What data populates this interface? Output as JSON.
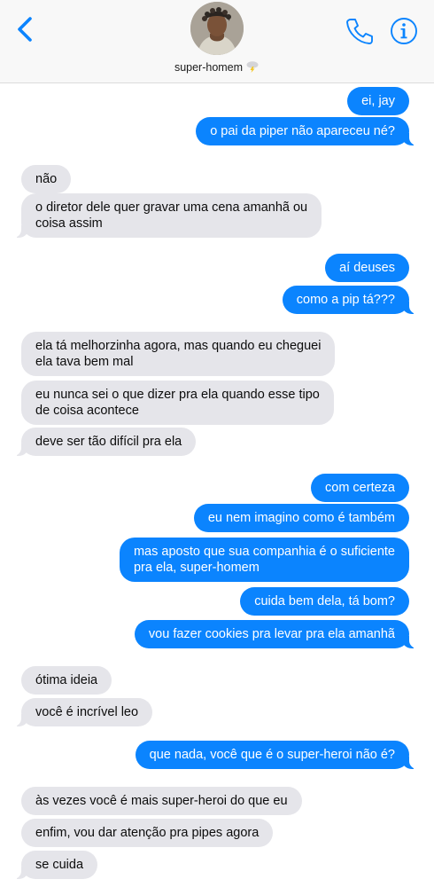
{
  "header": {
    "contact_name": "super-homem",
    "icons": {
      "back": "chevron-left-icon",
      "phone": "phone-icon",
      "info": "info-icon",
      "name_emoji": "cloud-lightning-icon"
    },
    "accent_color": "#0b84fe"
  },
  "messages": [
    {
      "from": "me",
      "text": "ei, jay"
    },
    {
      "from": "me",
      "text": "o pai da piper não apareceu né?"
    },
    {
      "from": "them",
      "text": "não"
    },
    {
      "from": "them",
      "text": "o diretor dele quer gravar uma cena amanhã ou\ncoisa assim"
    },
    {
      "from": "me",
      "text": "aí deuses"
    },
    {
      "from": "me",
      "text": "como a pip tá???"
    },
    {
      "from": "them",
      "text": "ela tá melhorzinha agora, mas quando eu cheguei\nela tava bem mal"
    },
    {
      "from": "them",
      "text": "eu nunca sei o que dizer pra ela quando esse tipo\nde coisa acontece"
    },
    {
      "from": "them",
      "text": "deve ser tão difícil pra ela"
    },
    {
      "from": "me",
      "text": "com certeza"
    },
    {
      "from": "me",
      "text": "eu nem imagino como é também"
    },
    {
      "from": "me",
      "text": "mas aposto que sua companhia é o suficiente\npra ela, super-homem"
    },
    {
      "from": "me",
      "text": "cuida bem dela, tá bom?"
    },
    {
      "from": "me",
      "text": "vou fazer cookies pra levar pra ela amanhã"
    },
    {
      "from": "them",
      "text": "ótima ideia"
    },
    {
      "from": "them",
      "text": "você é incrível leo"
    },
    {
      "from": "me",
      "text": "que nada, você que é o super-heroi não é?"
    },
    {
      "from": "them",
      "text": "às vezes você é mais super-heroi do que eu"
    },
    {
      "from": "them",
      "text": "enfim, vou dar atenção pra pipes agora"
    },
    {
      "from": "them",
      "text": "se cuida"
    }
  ]
}
